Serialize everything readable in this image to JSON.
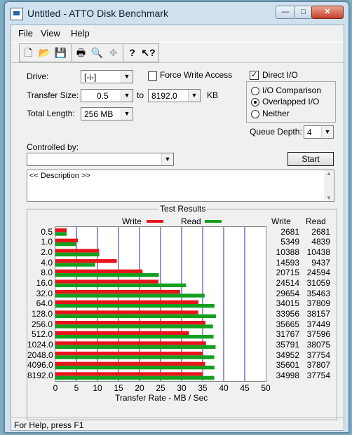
{
  "window": {
    "title": "Untitled - ATTO Disk Benchmark",
    "buttons": {
      "min": "—",
      "max": "□",
      "close": "✕"
    }
  },
  "menu": [
    "File",
    "View",
    "Help"
  ],
  "toolbar": [
    "new-icon",
    "open-icon",
    "save-icon",
    "print-icon",
    "print-preview-icon",
    "move-icon",
    "help-icon",
    "context-help-icon"
  ],
  "settings": {
    "drive_label": "Drive:",
    "drive_value": "[-i-]",
    "transfer_size_label": "Transfer Size:",
    "transfer_from": "0.5",
    "to_label": "to",
    "transfer_to": "8192.0",
    "kb_label": "KB",
    "total_length_label": "Total Length:",
    "total_length_value": "256 MB",
    "force_write_label": "Force Write Access",
    "force_write_checked": false,
    "direct_io_label": "Direct I/O",
    "direct_io_checked": true,
    "io_comparison_label": "I/O Comparison",
    "overlapped_io_label": "Overlapped I/O",
    "neither_label": "Neither",
    "selected_mode": "Overlapped I/O",
    "queue_depth_label": "Queue Depth:",
    "queue_depth_value": "4",
    "controlled_by_label": "Controlled by:",
    "controlled_by_value": "",
    "start_label": "Start",
    "description": "<< Description >>"
  },
  "results": {
    "title": "Test Results",
    "write_legend": "Write",
    "read_legend": "Read",
    "write_header": "Write",
    "read_header": "Read",
    "colors": {
      "write": "#e8141c",
      "read": "#13a01f"
    }
  },
  "chart_data": {
    "type": "bar",
    "orientation": "horizontal",
    "categories": [
      "0.5",
      "1.0",
      "2.0",
      "4.0",
      "8.0",
      "16.0",
      "32.0",
      "64.0",
      "128.0",
      "256.0",
      "512.0",
      "1024.0",
      "2048.0",
      "4096.0",
      "8192.0"
    ],
    "series": [
      {
        "name": "Write",
        "values": [
          2681,
          5349,
          10388,
          14593,
          20715,
          24514,
          29654,
          34015,
          33956,
          35665,
          31767,
          35791,
          34952,
          35601,
          34998
        ]
      },
      {
        "name": "Read",
        "values": [
          2681,
          4839,
          10438,
          9437,
          24594,
          31059,
          35463,
          37809,
          38157,
          37449,
          37596,
          38075,
          37754,
          37807,
          37754
        ]
      }
    ],
    "unit_scale": 1000,
    "xlabel": "Transfer Rate - MB / Sec",
    "xlim": [
      0,
      50
    ],
    "xticks": [
      "0",
      "5",
      "10",
      "15",
      "20",
      "25",
      "30",
      "35",
      "40",
      "45",
      "50"
    ],
    "grid": true
  },
  "status": "For Help, press F1"
}
